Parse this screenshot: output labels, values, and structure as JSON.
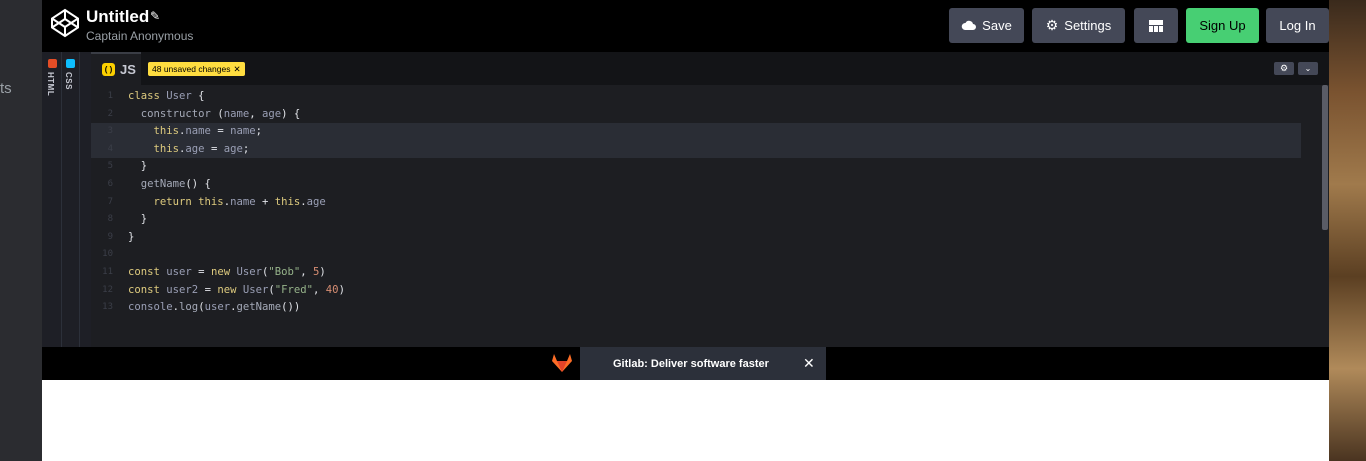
{
  "left_fragment": "ts",
  "header": {
    "title": "Untitled",
    "subtitle": "Captain Anonymous",
    "save_label": "Save",
    "settings_label": "Settings",
    "signup_label": "Sign Up",
    "login_label": "Log In"
  },
  "side_tabs": {
    "html_label": "HTML",
    "css_label": "CSS"
  },
  "editor": {
    "tab_label": "JS",
    "js_icon": "( )",
    "unsaved_label": "48 unsaved changes",
    "unsaved_close": "✕"
  },
  "code_lines": [
    {
      "n": "1",
      "tokens": [
        [
          "k",
          "class "
        ],
        [
          "v",
          "User "
        ],
        [
          "t",
          "{"
        ]
      ]
    },
    {
      "n": "2",
      "tokens": [
        [
          "t",
          "  "
        ],
        [
          "f",
          "constructor "
        ],
        [
          "t",
          "("
        ],
        [
          "v",
          "name"
        ],
        [
          "t",
          ", "
        ],
        [
          "v",
          "age"
        ],
        [
          "t",
          ") {"
        ]
      ]
    },
    {
      "n": "3",
      "tokens": [
        [
          "t",
          "    "
        ],
        [
          "k",
          "this"
        ],
        [
          "t",
          "."
        ],
        [
          "v",
          "name "
        ],
        [
          "t",
          "= "
        ],
        [
          "v",
          "name"
        ],
        [
          "t",
          ";"
        ]
      ]
    },
    {
      "n": "4",
      "tokens": [
        [
          "t",
          "    "
        ],
        [
          "k",
          "this"
        ],
        [
          "t",
          "."
        ],
        [
          "v",
          "age "
        ],
        [
          "t",
          "= "
        ],
        [
          "v",
          "age"
        ],
        [
          "t",
          ";"
        ]
      ]
    },
    {
      "n": "5",
      "tokens": [
        [
          "t",
          "  }"
        ]
      ]
    },
    {
      "n": "6",
      "tokens": [
        [
          "t",
          "  "
        ],
        [
          "f",
          "getName"
        ],
        [
          "t",
          "() {"
        ]
      ]
    },
    {
      "n": "7",
      "tokens": [
        [
          "t",
          "    "
        ],
        [
          "k",
          "return "
        ],
        [
          "k",
          "this"
        ],
        [
          "t",
          "."
        ],
        [
          "v",
          "name "
        ],
        [
          "t",
          "+ "
        ],
        [
          "k",
          "this"
        ],
        [
          "t",
          "."
        ],
        [
          "v",
          "age"
        ]
      ]
    },
    {
      "n": "8",
      "tokens": [
        [
          "t",
          "  }"
        ]
      ]
    },
    {
      "n": "9",
      "tokens": [
        [
          "t",
          "}"
        ]
      ]
    },
    {
      "n": "10",
      "tokens": []
    },
    {
      "n": "11",
      "tokens": [
        [
          "k",
          "const "
        ],
        [
          "v",
          "user "
        ],
        [
          "t",
          "= "
        ],
        [
          "k",
          "new "
        ],
        [
          "v",
          "User"
        ],
        [
          "t",
          "("
        ],
        [
          "s",
          "\"Bob\""
        ],
        [
          "t",
          ", "
        ],
        [
          "n",
          "5"
        ],
        [
          "t",
          ")"
        ]
      ]
    },
    {
      "n": "12",
      "tokens": [
        [
          "k",
          "const "
        ],
        [
          "v",
          "user2 "
        ],
        [
          "t",
          "= "
        ],
        [
          "k",
          "new "
        ],
        [
          "v",
          "User"
        ],
        [
          "t",
          "("
        ],
        [
          "s",
          "\"Fred\""
        ],
        [
          "t",
          ", "
        ],
        [
          "n",
          "40"
        ],
        [
          "t",
          ")"
        ]
      ]
    },
    {
      "n": "13",
      "tokens": [
        [
          "v",
          "console"
        ],
        [
          "t",
          "."
        ],
        [
          "f",
          "log"
        ],
        [
          "t",
          "("
        ],
        [
          "v",
          "user"
        ],
        [
          "t",
          "."
        ],
        [
          "f",
          "getName"
        ],
        [
          "t",
          "())"
        ]
      ]
    }
  ],
  "ad": {
    "text": "Gitlab: Deliver software faster",
    "close": "✕"
  },
  "icons": {
    "logo": "codepen-logo-icon",
    "save": "cloud-icon",
    "settings": "gear-icon",
    "layout": "layout-icon",
    "ad": "gitlab-fox-icon"
  },
  "colors": {
    "signup": "#47cf73",
    "button": "#444857",
    "unsaved_badge": "#ffdd40",
    "js_icon": "#fcd000"
  }
}
